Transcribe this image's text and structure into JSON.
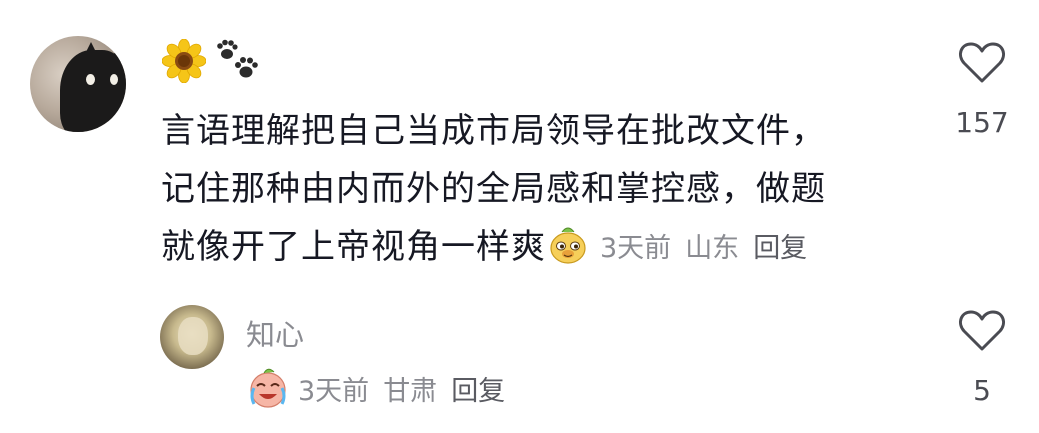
{
  "comment": {
    "lines": [
      "言语理解把自己当成市局领导在批改文件，",
      "记住那种由内而外的全局感和掌控感，做题",
      "就像开了上帝视角一样爽"
    ],
    "trailing_emoji": "smug-mole-emoji",
    "time": "3天前",
    "location": "山东",
    "reply_label": "回复",
    "likes": "157",
    "username_emojis": [
      "sunflower-emoji",
      "paw-prints-emoji"
    ]
  },
  "reply": {
    "username": "知心",
    "emoji": "crying-laughing-emoji",
    "time": "3天前",
    "location": "甘肃",
    "reply_label": "回复",
    "likes": "5"
  }
}
